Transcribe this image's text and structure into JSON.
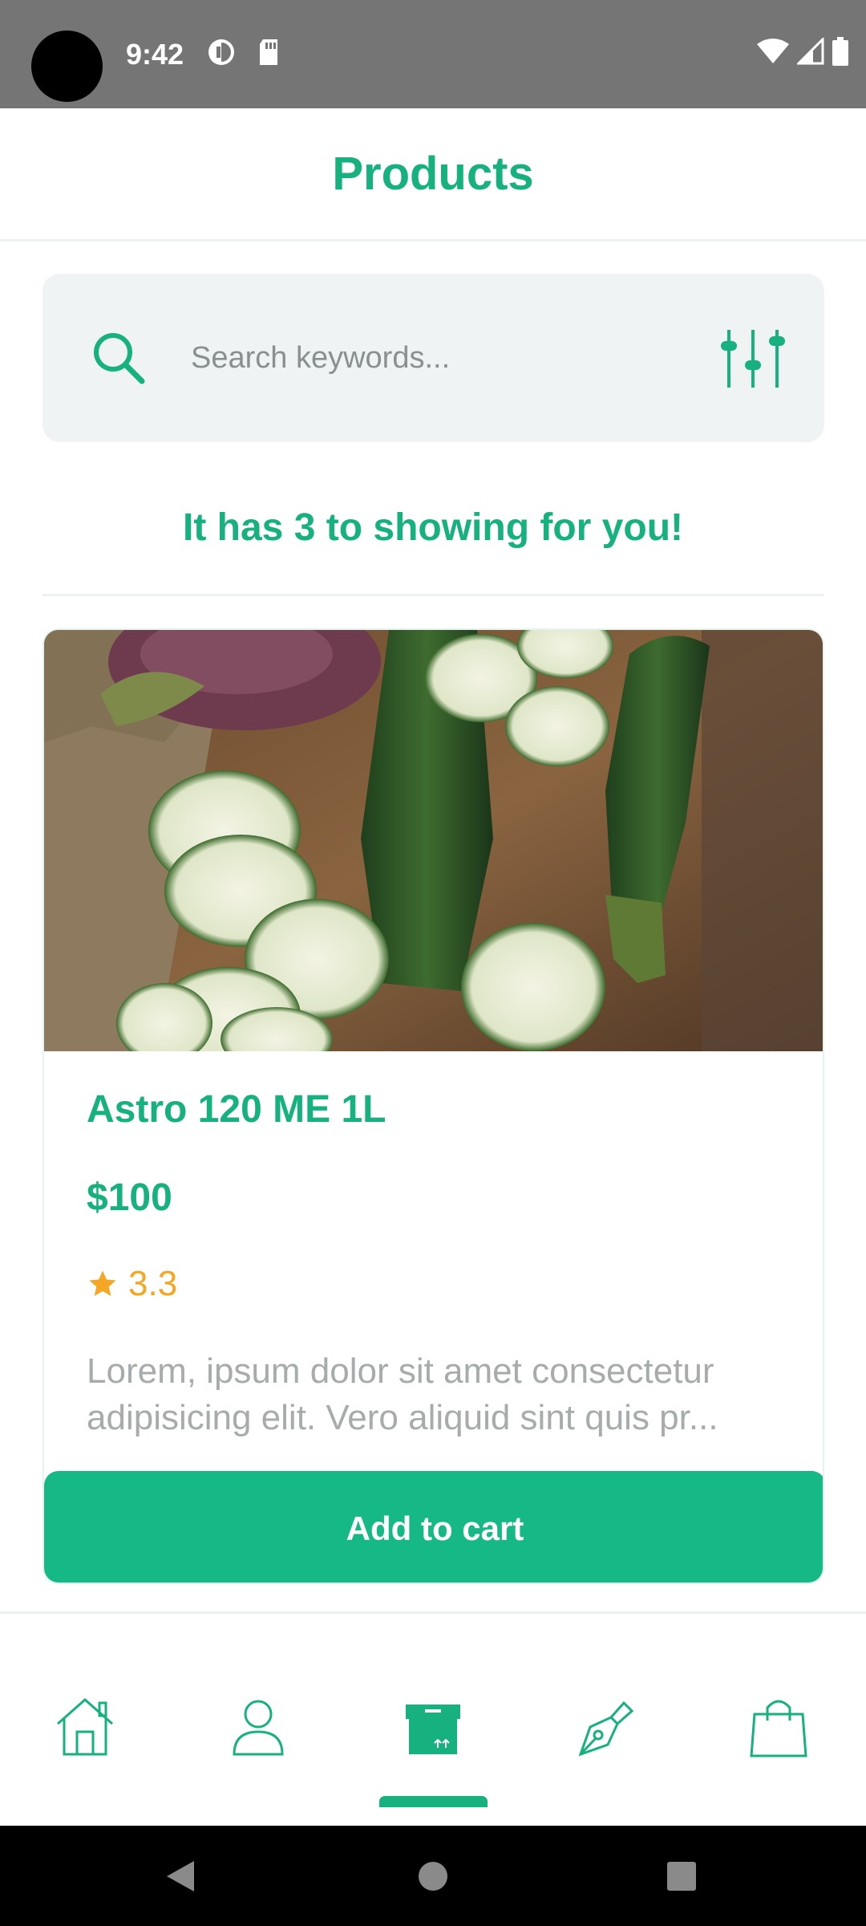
{
  "status_bar": {
    "time": "9:42",
    "icons_left": [
      "data-saver-icon",
      "sd-card-icon"
    ],
    "icons_right": [
      "wifi-icon",
      "signal-icon",
      "battery-icon"
    ]
  },
  "header": {
    "title": "Products"
  },
  "search": {
    "placeholder": "Search keywords...",
    "value": ""
  },
  "results": {
    "text": "It has 3 to showing for you!"
  },
  "product": {
    "image": "zucchini-image",
    "name": "Astro 120 ME 1L",
    "price": "$100",
    "rating": "3.3",
    "description": "Lorem, ipsum dolor sit amet consectetur adipisicing elit. Vero aliquid sint quis pr...",
    "add_to_cart_label": "Add to cart"
  },
  "bottom_nav": {
    "items": [
      {
        "icon": "home-icon",
        "active": false
      },
      {
        "icon": "user-icon",
        "active": false
      },
      {
        "icon": "box-icon",
        "active": true
      },
      {
        "icon": "pen-icon",
        "active": false
      },
      {
        "icon": "shopping-bag-icon",
        "active": false
      }
    ]
  },
  "colors": {
    "accent": "#16b17f",
    "button": "#16b985",
    "star": "#f5a623",
    "search_bg": "#eff3f3"
  }
}
